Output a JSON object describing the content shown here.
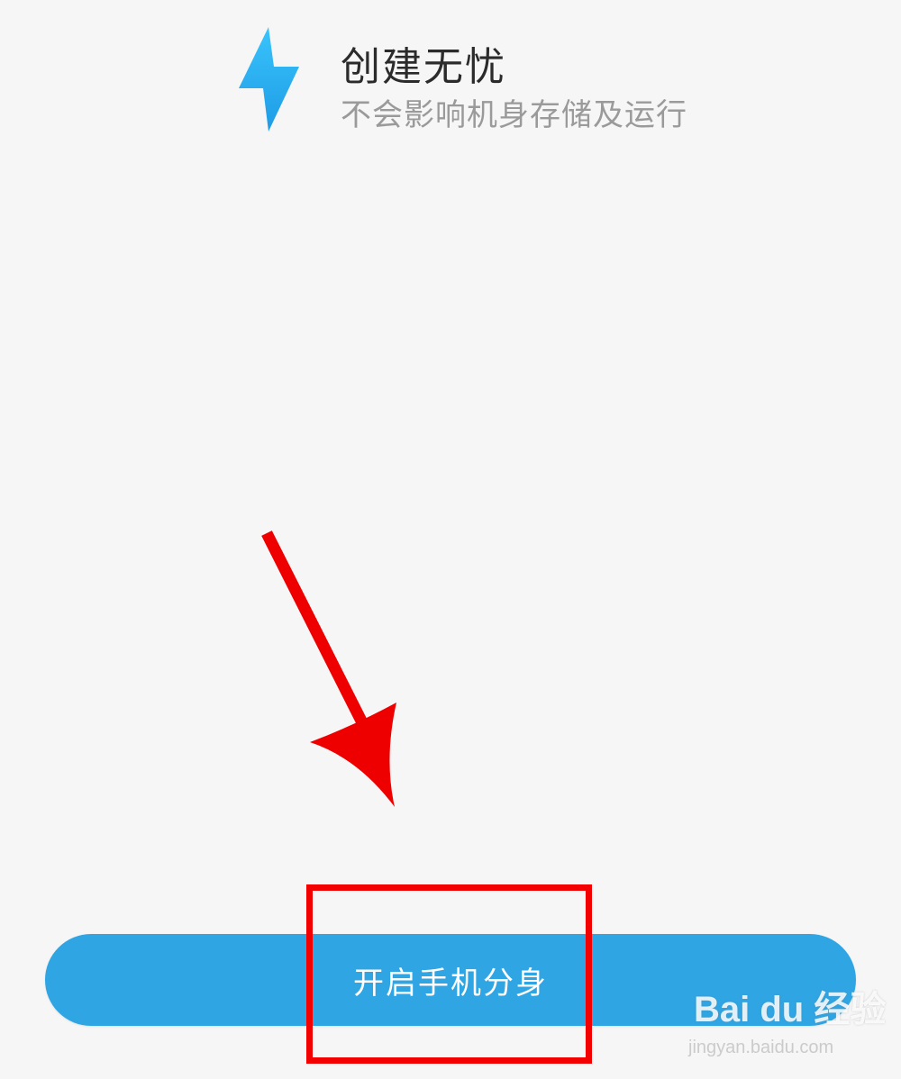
{
  "feature": {
    "title": "创建无忧",
    "subtitle": "不会影响机身存储及运行",
    "icon": "lightning-bolt-icon",
    "icon_color": "#29aef0"
  },
  "action": {
    "primary_button_label": "开启手机分身",
    "button_color": "#2fa5e4"
  },
  "annotation": {
    "arrow_color": "#ee0000",
    "highlight_color": "#f30000"
  },
  "watermark": {
    "logo_text": "Bai du 经验",
    "url": "jingyan.baidu.com"
  }
}
